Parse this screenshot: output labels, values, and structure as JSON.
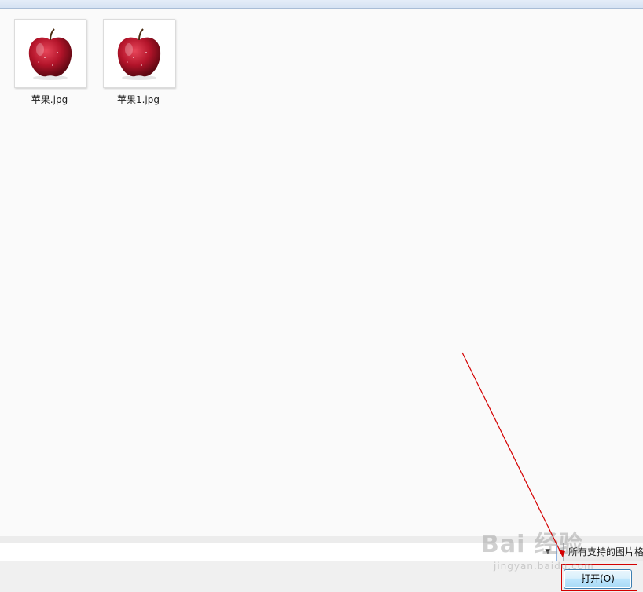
{
  "files": [
    {
      "name": "苹果.jpg",
      "icon": "apple-image-thumbnail"
    },
    {
      "name": "苹果1.jpg",
      "icon": "apple-image-thumbnail"
    }
  ],
  "filename_field": {
    "value": ""
  },
  "filetype_select": {
    "selected": "所有支持的图片格"
  },
  "buttons": {
    "open_label": "打开(O)"
  },
  "watermark": {
    "logo": "Bai 经验",
    "url": "jingyan.baidu.com"
  },
  "colors": {
    "annotation": "#d40000",
    "button_border": "#3c7fb1",
    "input_border": "#8db2e3"
  }
}
